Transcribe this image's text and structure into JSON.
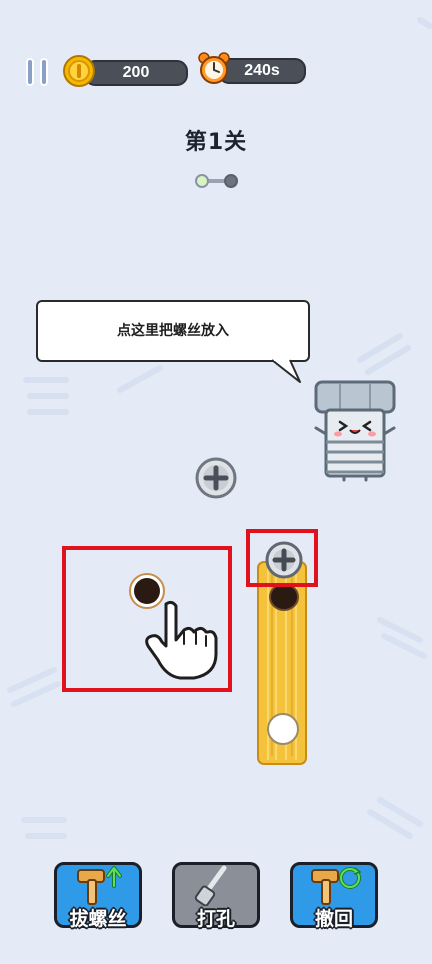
{
  "hud": {
    "coins": "200",
    "time": "240s"
  },
  "level": {
    "title": "第1关",
    "progress": {
      "current": 1,
      "total": 2
    }
  },
  "hint": {
    "text": "点这里把螺丝放入"
  },
  "toolbar": {
    "pull_screw_label": "拔螺丝",
    "drill_label": "打孔",
    "undo_label": "撤回"
  },
  "colors": {
    "background": "#e4ebf7",
    "highlight": "#e0121e",
    "plank": "#f5c33b",
    "button_blue": "#2f9be8",
    "button_gray": "#8a8f98"
  },
  "icons": [
    "pause-icon",
    "coin-icon",
    "alarm-clock-icon",
    "screw-icon",
    "hole-icon",
    "pointing-hand-icon",
    "hammer-icon",
    "screwdriver-icon",
    "undo-icon"
  ]
}
